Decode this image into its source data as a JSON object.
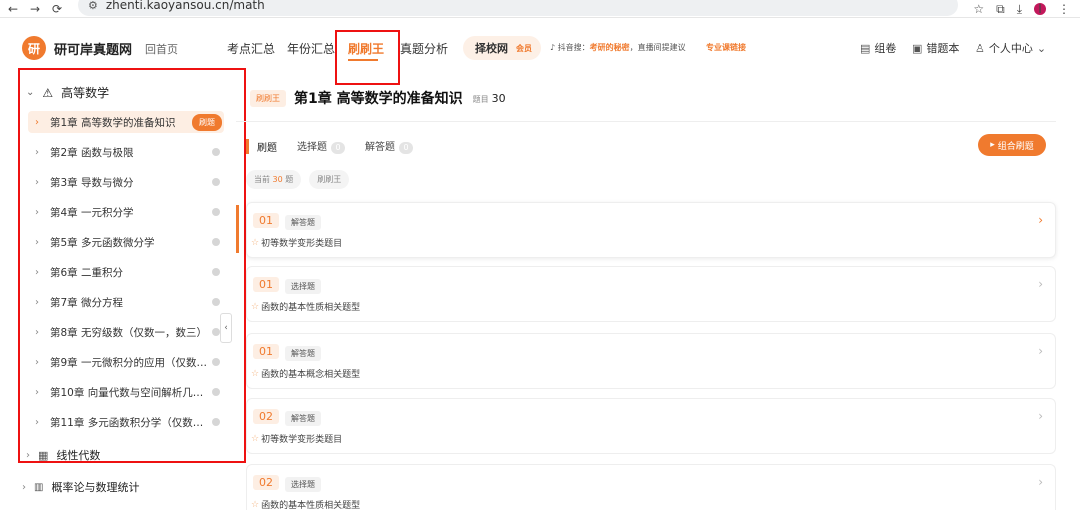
{
  "browser": {
    "url": "zhenti.kaoyansou.cn/math",
    "back": "←",
    "forward": "→",
    "reload": "⟳",
    "profile": "I"
  },
  "nav": {
    "logo_text": "研可岸真题网",
    "logo_mark": "研",
    "home": "回首页",
    "items": [
      "考点汇总",
      "年份汇总",
      "刷刷王",
      "真题分析"
    ],
    "pill_label": "择校网",
    "pill_vip": "会员",
    "promo_prefix": "抖音搜：",
    "promo_highlight": "考研的秘密",
    "promo_suffix": "，直播间提建议",
    "promo2": "专业课链接",
    "tools": [
      "组卷",
      "错题本",
      "个人中心"
    ]
  },
  "sidebar": {
    "section_title": "高等数学",
    "chapters": [
      "第1章 高等数学的准备知识",
      "第2章 函数与极限",
      "第3章 导数与微分",
      "第4章 一元积分学",
      "第5章 多元函数微分学",
      "第6章 二重积分",
      "第7章 微分方程",
      "第8章 无穷级数（仅数一，数三）",
      "第9章 一元微积分的应用（仅数…",
      "第10章 向量代数与空间解析几…",
      "第11章 多元函数积分学（仅数…"
    ],
    "active_tag": "刷题",
    "linear": "线性代数",
    "probability": "概率论与数理统计"
  },
  "main": {
    "tag": "刷刷王",
    "title": "第1章 高等数学的准备知识",
    "count_label": "题目",
    "count": "30",
    "tabs": [
      "刷题",
      "选择题",
      "解答题"
    ],
    "tab_counts": [
      "0",
      "0"
    ],
    "combo_button": "组合刷题",
    "chip_current_prefix": "当前",
    "chip_current_num": "30",
    "chip_current_suffix": "题",
    "chip2": "刷刷王",
    "cards": [
      {
        "no": "01",
        "type": "解答题",
        "topic": "初等数学变形类题目"
      },
      {
        "no": "01",
        "type": "选择题",
        "topic": "函数的基本性质相关题型"
      },
      {
        "no": "01",
        "type": "解答题",
        "topic": "函数的基本概念相关题型"
      },
      {
        "no": "02",
        "type": "解答题",
        "topic": "初等数学变形类题目"
      },
      {
        "no": "02",
        "type": "选择题",
        "topic": "函数的基本性质相关题型"
      }
    ]
  },
  "colors": {
    "accent": "#f07a2e",
    "highlight": "#e11111"
  }
}
